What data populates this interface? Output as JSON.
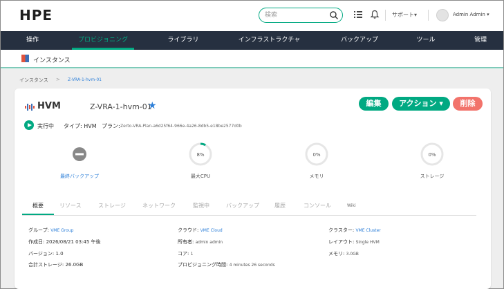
{
  "header": {
    "logo": "HPE",
    "search_placeholder": "検索",
    "support_label": "サポート▾",
    "user_label": "Admin Admin ▾"
  },
  "nav": {
    "items": [
      "操作",
      "プロビジョニング",
      "ライブラリ",
      "インフラストラクチャ",
      "バックアップ",
      "ツール",
      "管理"
    ],
    "active": "プロビジョニング"
  },
  "subheader": {
    "title": "インスタンス"
  },
  "breadcrumb": {
    "root": "インスタンス",
    "separator": ">",
    "current": "Z-VRA-1-hvm-01"
  },
  "instance": {
    "type_badge": "HVM",
    "name": "Z-VRA-1-hvm-01",
    "favorite_icon": "star-icon",
    "status_label": "実行中",
    "type_text": "タイプ: HVM",
    "plan_label": "プラン:",
    "plan_value": "Zerto-VRA-Plan-a6d25f64-966e-4a26-8db5-e18be2577d0b"
  },
  "actions": {
    "edit": "編集",
    "actions": "アクション ▾",
    "delete": "削除",
    "colors": {
      "primary": "#01a982",
      "danger": "#f2736b"
    }
  },
  "stats": {
    "backup_label": "最終バックアップ",
    "cpu_label": "最大CPU",
    "cpu_value": "8%",
    "cpu_fraction": 0.08,
    "memory_label": "メモリ",
    "memory_value": "0%",
    "memory_fraction": 0.0,
    "storage_label": "ストレージ",
    "storage_value": "0%",
    "storage_fraction": 0.0
  },
  "tabs": [
    "概要",
    "リソース",
    "ストレージ",
    "ネットワーク",
    "監視中",
    "バックアップ",
    "履歴",
    "コンソール",
    "Wiki"
  ],
  "details": {
    "group_label": "グループ:",
    "group_value": "VME Group",
    "created_label": "作成日: 2026/08/21 03:45 午後",
    "version_label": "バージョン: 1.0",
    "total_storage_label": "合計ストレージ: 26.0GB",
    "cloud_label": "クラウド:",
    "cloud_value": "VME Cloud",
    "owner_label": "所有者:",
    "owner_value": "admin admin",
    "cores_label": "コア:",
    "cores_value": "1",
    "provision_label": "プロビジョニング時間:",
    "provision_value": "4 minutes 26 seconds",
    "cluster_label": "クラスター:",
    "cluster_value": "VME Cluster",
    "layout_label": "レイアウト:",
    "layout_value": "Single HVM",
    "memory_label": "メモリ:",
    "memory_value": "3.0GB"
  }
}
